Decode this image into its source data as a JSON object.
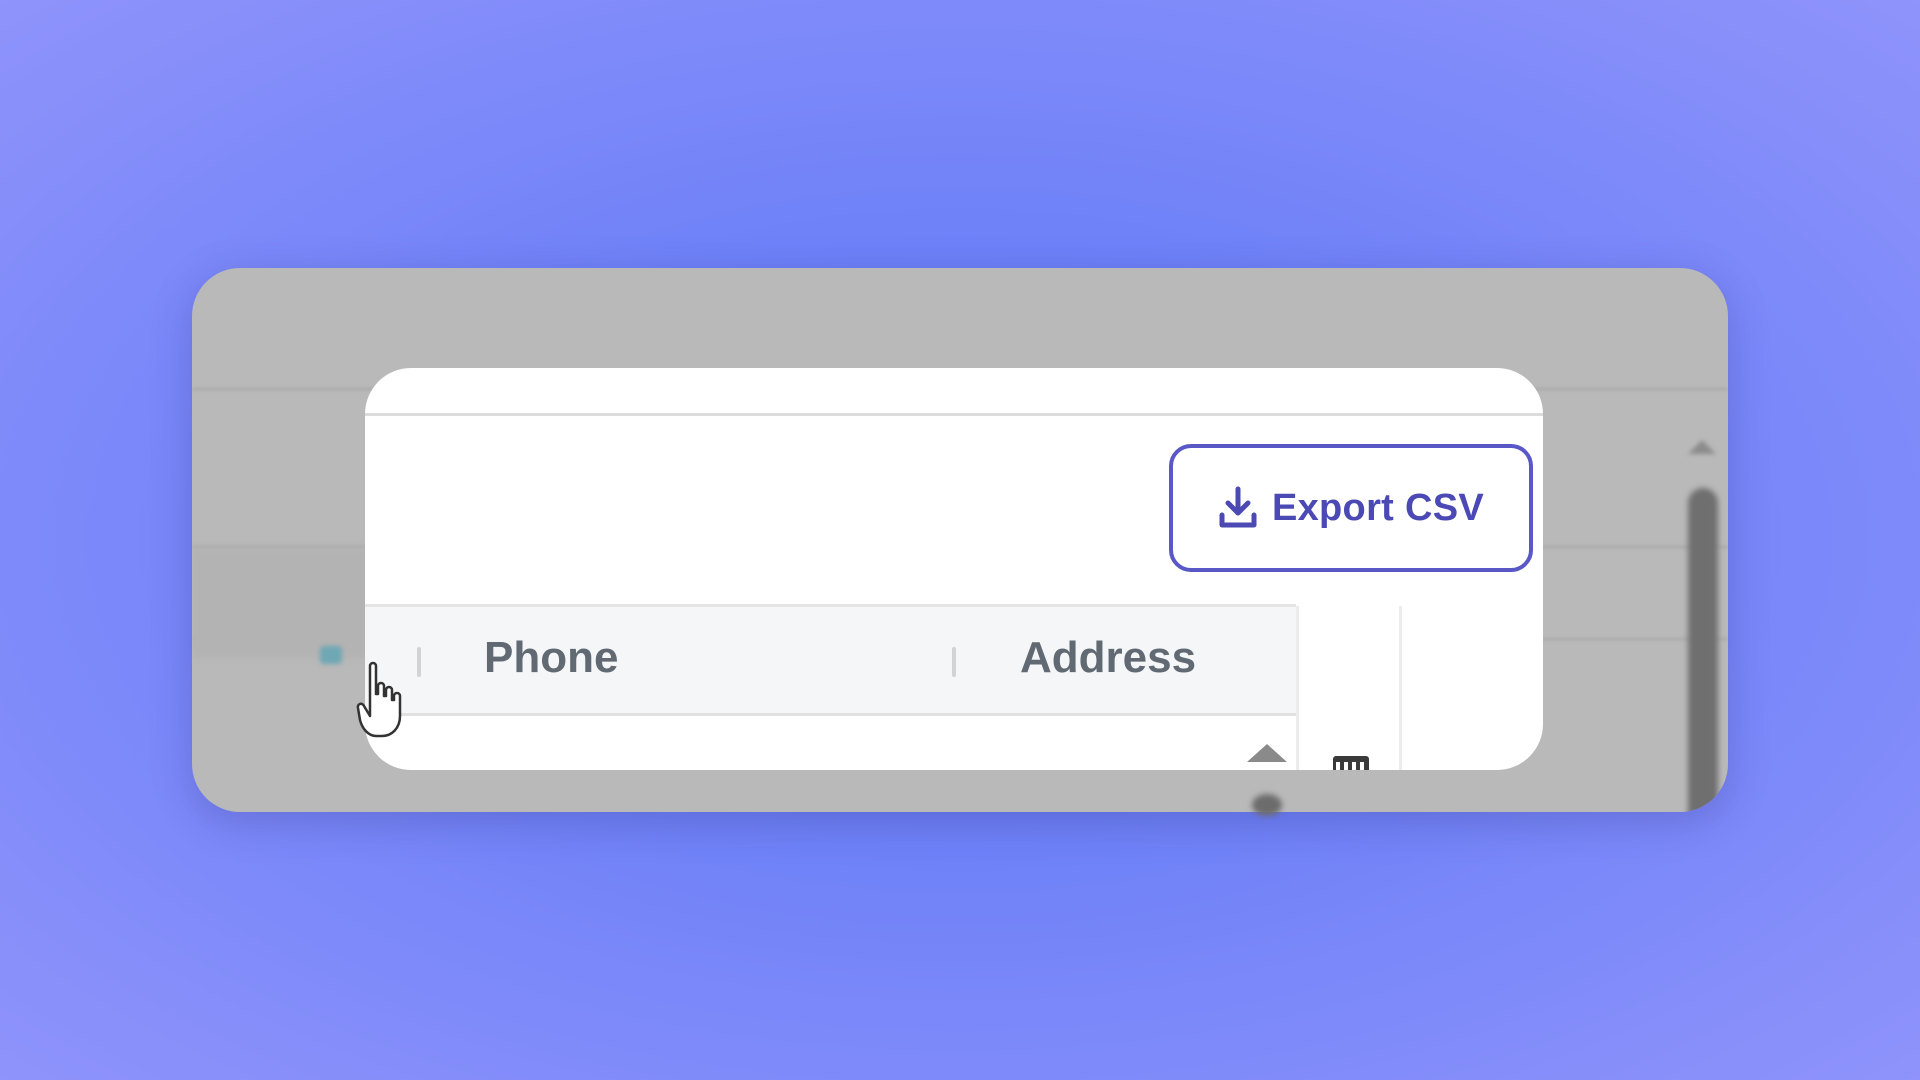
{
  "toolbar": {
    "export_label": "Export CSV",
    "export_icon": "download-icon"
  },
  "table": {
    "columns": [
      "Phone",
      "Address"
    ]
  },
  "colors": {
    "background": "#6b7ff7",
    "accent": "#5a57c6",
    "card": "#ffffff",
    "blurred_card": "#b9b9b9"
  },
  "icons": {
    "cursor": "hand-pointer-icon",
    "sort": "sort-up-icon",
    "grid": "grid-icon"
  }
}
